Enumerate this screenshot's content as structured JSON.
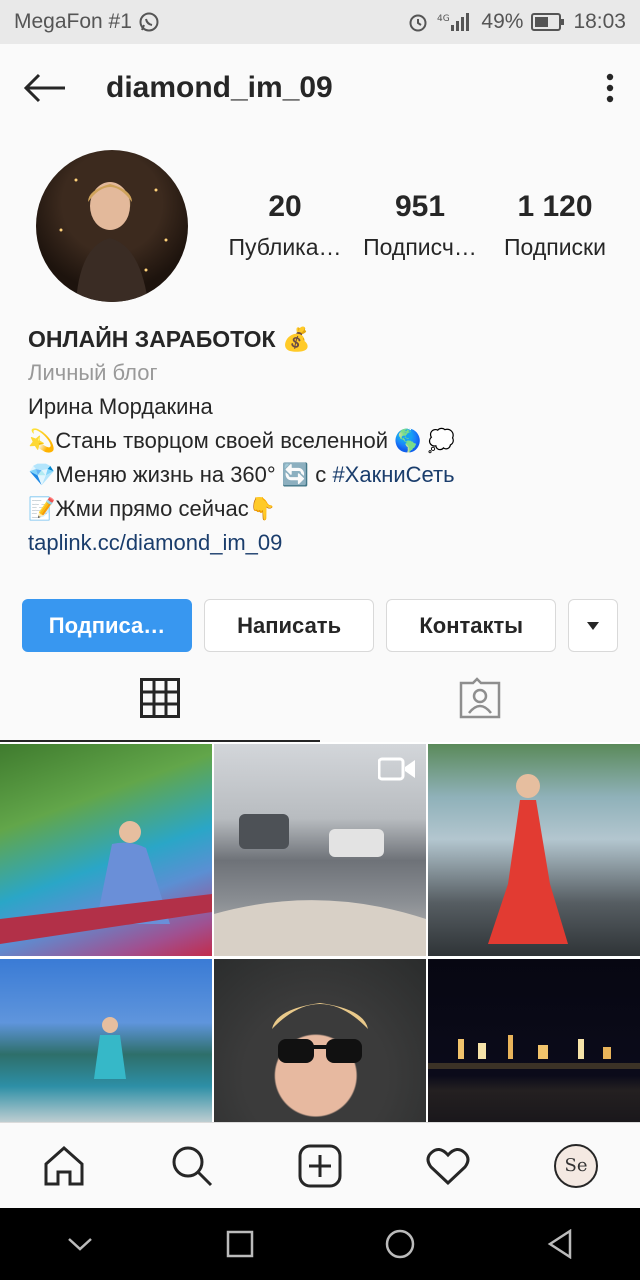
{
  "status_bar": {
    "carrier": "MegaFon #1",
    "network": "4G",
    "battery": "49%",
    "time": "18:03"
  },
  "header": {
    "username": "diamond_im_09"
  },
  "stats": [
    {
      "value": "20",
      "label": "Публика…"
    },
    {
      "value": "951",
      "label": "Подписч…"
    },
    {
      "value": "1 120",
      "label": "Подписки"
    }
  ],
  "bio": {
    "title": "ОНЛАЙН ЗАРАБОТОК 💰",
    "category": "Личный блог",
    "name": "Ирина Мордакина",
    "line1": "💫Стань творцом своей вселенной 🌎 💭",
    "line2_prefix": "💎Меняю жизнь на 360° 🔄 с ",
    "line2_hashtag": "#ХакниСеть",
    "line3": "📝Жми прямо сейчас👇",
    "link": "taplink.cc/diamond_im_09"
  },
  "actions": {
    "follow": "Подписа…",
    "message": "Написать",
    "contacts": "Контакты"
  },
  "grid": {
    "video_post_index": 1,
    "posts": [
      {
        "description": "woman in blue dress sitting on railing"
      },
      {
        "description": "road traffic from car window"
      },
      {
        "description": "woman in red dress by fountains"
      },
      {
        "description": "woman sitting by lake"
      },
      {
        "description": "selfie with sunglasses in car"
      },
      {
        "description": "city lights at night"
      }
    ]
  },
  "bottom_nav": {
    "avatar_text": "Se"
  },
  "colors": {
    "accent": "#3897f0",
    "link": "#1a3d6c"
  }
}
